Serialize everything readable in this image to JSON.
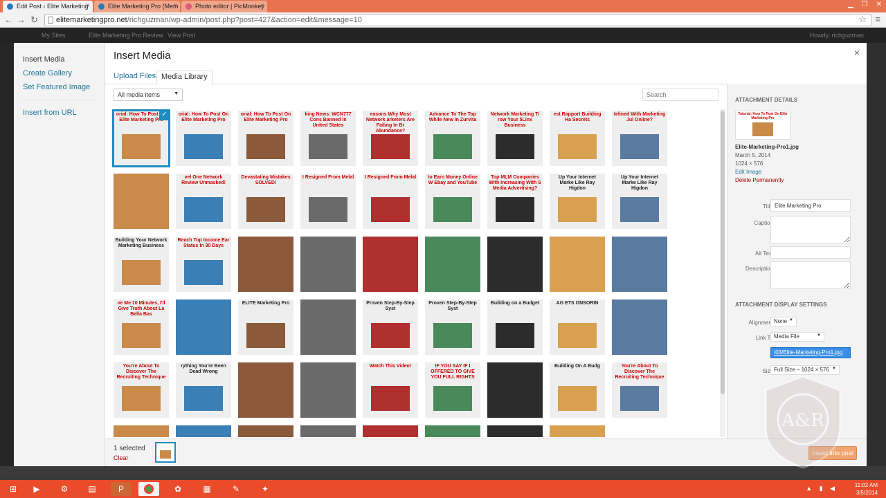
{
  "browser": {
    "tabs": [
      {
        "label": "Edit Post ‹ Elite Marketing"
      },
      {
        "label": "Elite Marketing Pro (Mem"
      },
      {
        "label": "Photo editor | PicMonkey"
      }
    ],
    "url_domain": "elitemarketingpro.net",
    "url_path": "/richguzman/wp-admin/post.php?post=427&action=edit&message=10"
  },
  "adminbar": {
    "my_sites": "My Sites",
    "site": "Elite Marketing Pro Review",
    "view_post": "View Post",
    "howdy": "Howdy, richguzman"
  },
  "modal": {
    "menu": {
      "insert_media": "Insert Media",
      "create_gallery": "Create Gallery",
      "set_featured_image": "Set Featured Image",
      "insert_from_url": "Insert from URL"
    },
    "title": "Insert Media",
    "close": "×",
    "tabs": {
      "upload": "Upload Files",
      "library": "Media Library"
    },
    "filter": "All media items",
    "search_placeholder": "Search",
    "thumbs": [
      {
        "text": "orial: How To Post On Elite Marketing Pro",
        "style": "red"
      },
      {
        "text": "orial: How To Post On Elite Marketing Pro",
        "style": "red"
      },
      {
        "text": "orial: How To Post On Elite Marketing Pro",
        "style": "red"
      },
      {
        "text": "king News: WCN777 Cons Banned In United States",
        "style": "red"
      },
      {
        "text": "easons Why Most Network arketers Are Failing In Br Abundance?",
        "style": "red"
      },
      {
        "text": "Advance To The Top While New In Zurvita",
        "style": "red"
      },
      {
        "text": "Network Marketing Ti row Your 5Linx Business",
        "style": "red"
      },
      {
        "text": "est Rapport Building Ha Secrets",
        "style": "red"
      },
      {
        "text": "telined With Marketing Jul Online?",
        "style": "red"
      },
      {
        "text": "",
        "style": "dark"
      },
      {
        "text": "vel One Network Review Unmasked!",
        "style": "red"
      },
      {
        "text": "Devastating Mistakes SOLVED!",
        "style": "red"
      },
      {
        "text": "I Resigned From Melal",
        "style": "red"
      },
      {
        "text": "I Resigned From Melal",
        "style": "red"
      },
      {
        "text": "to Earn Money Online W Ebay and YouTube",
        "style": "red"
      },
      {
        "text": "Top MLM Companies With Increasing With S Media Advertising?",
        "style": "red"
      },
      {
        "text": "Up Your Internet Marke Like Ray Higdon",
        "style": "dark"
      },
      {
        "text": "Up Your Internet Marke Like Ray Higdon",
        "style": "dark"
      },
      {
        "text": "Building Your Network Marketing Business",
        "style": "dark"
      },
      {
        "text": "Reach Top Income Ear Status In 30 Days",
        "style": "red"
      },
      {
        "text": "",
        "style": "dark"
      },
      {
        "text": "",
        "style": "dark"
      },
      {
        "text": "",
        "style": "dark"
      },
      {
        "text": "",
        "style": "dark"
      },
      {
        "text": "",
        "style": "dark"
      },
      {
        "text": "",
        "style": "dark"
      },
      {
        "text": "",
        "style": "dark"
      },
      {
        "text": "ve Me 10 Minutes, I'll Give Truth About La Bella Bas",
        "style": "red"
      },
      {
        "text": "",
        "style": "dark"
      },
      {
        "text": "ELITE Marketing Pro",
        "style": "dark"
      },
      {
        "text": "",
        "style": "dark"
      },
      {
        "text": "Proven Step-By-Step Syst",
        "style": "dark"
      },
      {
        "text": "Proven Step-By-Step Syst",
        "style": "dark"
      },
      {
        "text": "Building on a Budget",
        "style": "dark"
      },
      {
        "text": "AG ETS ONSORIN",
        "style": "dark"
      },
      {
        "text": "",
        "style": "dark"
      },
      {
        "text": "You're About To Discover The Recruiting Technique",
        "style": "red"
      },
      {
        "text": "rything You're Been Dead Wrong",
        "style": "dark"
      },
      {
        "text": "",
        "style": "dark"
      },
      {
        "text": "",
        "style": "dark"
      },
      {
        "text": "Watch This Video!",
        "style": "red"
      },
      {
        "text": "IF YOU SAY IF I OFFERED TO GIVE YOU FULL RIGHTS",
        "style": "red"
      },
      {
        "text": "",
        "style": "dark"
      },
      {
        "text": "Building On A Budg",
        "style": "dark"
      },
      {
        "text": "You're About To Discover The Recruiting Technique",
        "style": "red"
      },
      {
        "text": "",
        "style": "dark"
      },
      {
        "text": "",
        "style": "dark"
      },
      {
        "text": "",
        "style": "dark"
      },
      {
        "text": "",
        "style": "dark"
      },
      {
        "text": "",
        "style": "dark"
      },
      {
        "text": "",
        "style": "dark"
      },
      {
        "text": "",
        "style": "dark"
      },
      {
        "text": "",
        "style": "dark"
      }
    ],
    "sidebar": {
      "details_heading": "ATTACHMENT DETAILS",
      "thumb_caption": "Tutorial: How To Post On Elite Marketing Pro",
      "filename": "Elite-Marketing-Pro1.jpg",
      "date": "March 5, 2014",
      "dimensions": "1024 × 576",
      "edit_image": "Edit Image",
      "delete_permanently": "Delete Permanently",
      "title_label": "Title",
      "title_value": "Elite Marketing Pro",
      "caption_label": "Caption",
      "alt_label": "Alt Text",
      "description_label": "Description",
      "display_heading": "ATTACHMENT DISPLAY SETTINGS",
      "alignment_label": "Alignment",
      "alignment_value": "None",
      "link_label": "Link To",
      "link_value": "Media File",
      "link_url": "/03/Elite-Marketing-Pro1.jpg",
      "size_label": "Size",
      "size_value": "Full Size – 1024 × 576"
    },
    "bottom": {
      "selected": "1 selected",
      "clear": "Clear",
      "insert": "Insert into post"
    }
  },
  "taskbar": {
    "time": "11:02 AM",
    "date": "3/5/2014"
  },
  "colors": {
    "accent": "#1e8cbe",
    "link": "#21759b",
    "delete": "#aa0000",
    "taskbar": "#e94b2b"
  }
}
